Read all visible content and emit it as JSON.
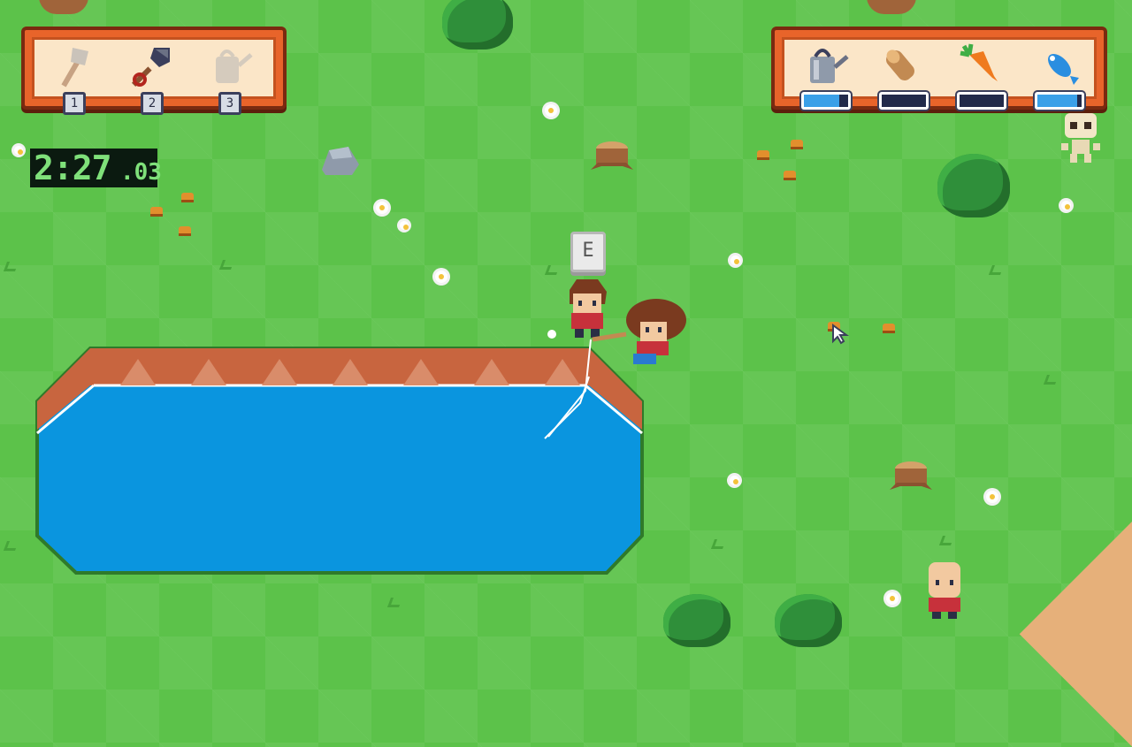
{
  "tool_bar": {
    "slots": [
      {
        "icon": "axe-icon",
        "key": "1"
      },
      {
        "icon": "shovel-icon",
        "key": "2"
      },
      {
        "icon": "watering-can-icon",
        "key": "3"
      }
    ]
  },
  "resource_bar": {
    "items": [
      {
        "icon": "watering-can-icon",
        "fill": 0.8
      },
      {
        "icon": "wood-log-icon",
        "fill": 0
      },
      {
        "icon": "carrot-icon",
        "fill": 0
      },
      {
        "icon": "fish-icon",
        "fill": 0.9
      }
    ]
  },
  "timer": {
    "main": "2:27",
    "fraction": ".03"
  },
  "prompt": {
    "key": "E"
  },
  "colors": {
    "grass": "#5cc24a",
    "water": "#0a95df",
    "bar_orange": "#e8642a",
    "timer_text": "#7fe07a"
  }
}
